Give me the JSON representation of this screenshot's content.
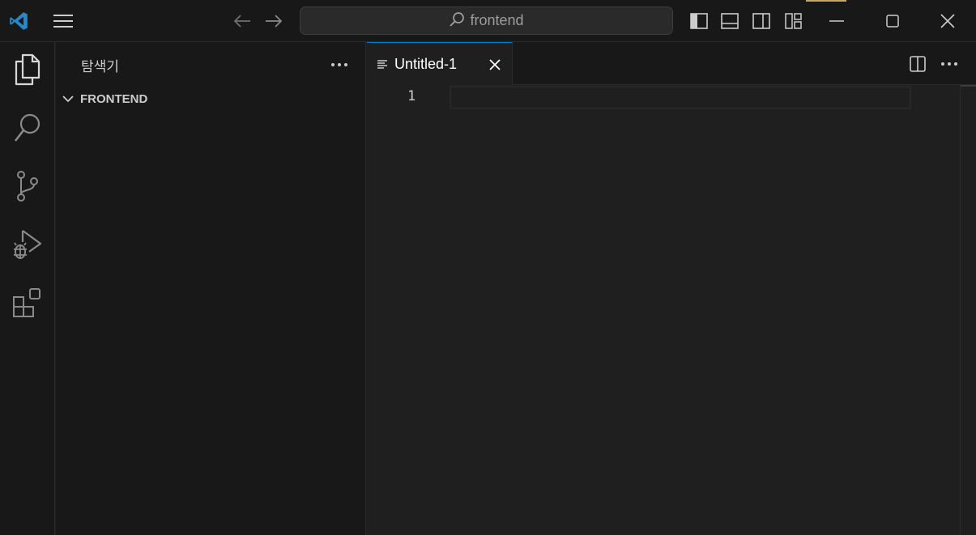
{
  "titlebar": {
    "search_label": "frontend",
    "icons": {
      "app": "vscode-logo",
      "menu": "hamburger-menu-icon",
      "back": "arrow-left-icon",
      "forward": "arrow-right-icon",
      "toggle_primary_sidebar": "layout-sidebar-left-icon",
      "toggle_panel": "layout-panel-icon",
      "toggle_secondary_sidebar": "layout-sidebar-right-icon",
      "customize_layout": "layout-customize-icon",
      "minimize": "minimize-icon",
      "maximize": "maximize-icon",
      "close": "close-icon"
    }
  },
  "activitybar": {
    "items": [
      {
        "name": "explorer",
        "icon": "files-icon",
        "active": true
      },
      {
        "name": "search",
        "icon": "search-icon",
        "active": false
      },
      {
        "name": "source-control",
        "icon": "source-control-icon",
        "active": false
      },
      {
        "name": "run-and-debug",
        "icon": "run-debug-icon",
        "active": false
      },
      {
        "name": "extensions",
        "icon": "extensions-icon",
        "active": false
      }
    ]
  },
  "sidebar": {
    "title": "탐색기",
    "more_icon": "ellipsis-icon",
    "folder": {
      "name": "FRONTEND",
      "expanded": true
    }
  },
  "editor": {
    "tabs": [
      {
        "label": "Untitled-1",
        "icon": "text-file-icon",
        "active": true
      }
    ],
    "actions": [
      "split-editor-icon",
      "ellipsis-icon"
    ],
    "lines": [
      "1"
    ]
  },
  "colors": {
    "accent": "#0078d4",
    "logo": "#2489ca",
    "background": "#1f1f1f",
    "chrome": "#181818"
  }
}
